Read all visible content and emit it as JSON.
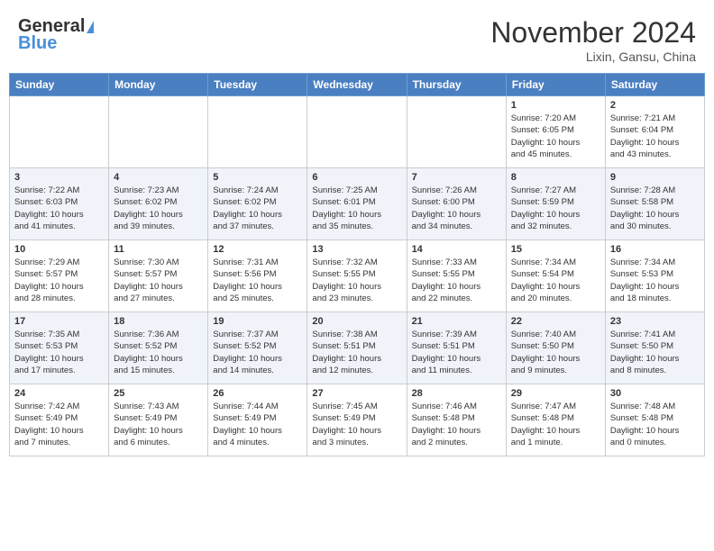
{
  "header": {
    "logo_line1": "General",
    "logo_line2": "Blue",
    "month": "November 2024",
    "location": "Lixin, Gansu, China"
  },
  "weekdays": [
    "Sunday",
    "Monday",
    "Tuesday",
    "Wednesday",
    "Thursday",
    "Friday",
    "Saturday"
  ],
  "weeks": [
    [
      {
        "day": "",
        "info": ""
      },
      {
        "day": "",
        "info": ""
      },
      {
        "day": "",
        "info": ""
      },
      {
        "day": "",
        "info": ""
      },
      {
        "day": "",
        "info": ""
      },
      {
        "day": "1",
        "info": "Sunrise: 7:20 AM\nSunset: 6:05 PM\nDaylight: 10 hours\nand 45 minutes."
      },
      {
        "day": "2",
        "info": "Sunrise: 7:21 AM\nSunset: 6:04 PM\nDaylight: 10 hours\nand 43 minutes."
      }
    ],
    [
      {
        "day": "3",
        "info": "Sunrise: 7:22 AM\nSunset: 6:03 PM\nDaylight: 10 hours\nand 41 minutes."
      },
      {
        "day": "4",
        "info": "Sunrise: 7:23 AM\nSunset: 6:02 PM\nDaylight: 10 hours\nand 39 minutes."
      },
      {
        "day": "5",
        "info": "Sunrise: 7:24 AM\nSunset: 6:02 PM\nDaylight: 10 hours\nand 37 minutes."
      },
      {
        "day": "6",
        "info": "Sunrise: 7:25 AM\nSunset: 6:01 PM\nDaylight: 10 hours\nand 35 minutes."
      },
      {
        "day": "7",
        "info": "Sunrise: 7:26 AM\nSunset: 6:00 PM\nDaylight: 10 hours\nand 34 minutes."
      },
      {
        "day": "8",
        "info": "Sunrise: 7:27 AM\nSunset: 5:59 PM\nDaylight: 10 hours\nand 32 minutes."
      },
      {
        "day": "9",
        "info": "Sunrise: 7:28 AM\nSunset: 5:58 PM\nDaylight: 10 hours\nand 30 minutes."
      }
    ],
    [
      {
        "day": "10",
        "info": "Sunrise: 7:29 AM\nSunset: 5:57 PM\nDaylight: 10 hours\nand 28 minutes."
      },
      {
        "day": "11",
        "info": "Sunrise: 7:30 AM\nSunset: 5:57 PM\nDaylight: 10 hours\nand 27 minutes."
      },
      {
        "day": "12",
        "info": "Sunrise: 7:31 AM\nSunset: 5:56 PM\nDaylight: 10 hours\nand 25 minutes."
      },
      {
        "day": "13",
        "info": "Sunrise: 7:32 AM\nSunset: 5:55 PM\nDaylight: 10 hours\nand 23 minutes."
      },
      {
        "day": "14",
        "info": "Sunrise: 7:33 AM\nSunset: 5:55 PM\nDaylight: 10 hours\nand 22 minutes."
      },
      {
        "day": "15",
        "info": "Sunrise: 7:34 AM\nSunset: 5:54 PM\nDaylight: 10 hours\nand 20 minutes."
      },
      {
        "day": "16",
        "info": "Sunrise: 7:34 AM\nSunset: 5:53 PM\nDaylight: 10 hours\nand 18 minutes."
      }
    ],
    [
      {
        "day": "17",
        "info": "Sunrise: 7:35 AM\nSunset: 5:53 PM\nDaylight: 10 hours\nand 17 minutes."
      },
      {
        "day": "18",
        "info": "Sunrise: 7:36 AM\nSunset: 5:52 PM\nDaylight: 10 hours\nand 15 minutes."
      },
      {
        "day": "19",
        "info": "Sunrise: 7:37 AM\nSunset: 5:52 PM\nDaylight: 10 hours\nand 14 minutes."
      },
      {
        "day": "20",
        "info": "Sunrise: 7:38 AM\nSunset: 5:51 PM\nDaylight: 10 hours\nand 12 minutes."
      },
      {
        "day": "21",
        "info": "Sunrise: 7:39 AM\nSunset: 5:51 PM\nDaylight: 10 hours\nand 11 minutes."
      },
      {
        "day": "22",
        "info": "Sunrise: 7:40 AM\nSunset: 5:50 PM\nDaylight: 10 hours\nand 9 minutes."
      },
      {
        "day": "23",
        "info": "Sunrise: 7:41 AM\nSunset: 5:50 PM\nDaylight: 10 hours\nand 8 minutes."
      }
    ],
    [
      {
        "day": "24",
        "info": "Sunrise: 7:42 AM\nSunset: 5:49 PM\nDaylight: 10 hours\nand 7 minutes."
      },
      {
        "day": "25",
        "info": "Sunrise: 7:43 AM\nSunset: 5:49 PM\nDaylight: 10 hours\nand 6 minutes."
      },
      {
        "day": "26",
        "info": "Sunrise: 7:44 AM\nSunset: 5:49 PM\nDaylight: 10 hours\nand 4 minutes."
      },
      {
        "day": "27",
        "info": "Sunrise: 7:45 AM\nSunset: 5:49 PM\nDaylight: 10 hours\nand 3 minutes."
      },
      {
        "day": "28",
        "info": "Sunrise: 7:46 AM\nSunset: 5:48 PM\nDaylight: 10 hours\nand 2 minutes."
      },
      {
        "day": "29",
        "info": "Sunrise: 7:47 AM\nSunset: 5:48 PM\nDaylight: 10 hours\nand 1 minute."
      },
      {
        "day": "30",
        "info": "Sunrise: 7:48 AM\nSunset: 5:48 PM\nDaylight: 10 hours\nand 0 minutes."
      }
    ]
  ]
}
